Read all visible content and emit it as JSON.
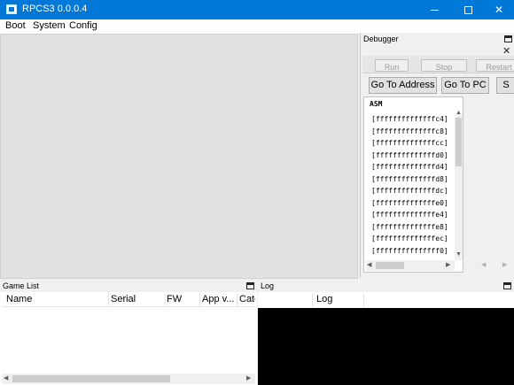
{
  "window": {
    "title": "RPCS3 0.0.0.4"
  },
  "menubar": {
    "items": [
      "Boot",
      "System",
      "Config"
    ]
  },
  "debugger": {
    "title": "Debugger",
    "close_glyph": "✕",
    "toolbar": [
      "Run",
      "Stop",
      "Restart"
    ],
    "buttons": {
      "go_to_address": "Go To Address",
      "go_to_pc": "Go To PC",
      "third": "S"
    },
    "asm_header": "ASM",
    "asm_rows": [
      "[ffffffffffffffc4]",
      "[ffffffffffffffc8]",
      "[ffffffffffffffcc]",
      "[ffffffffffffffd0]",
      "[ffffffffffffffd4]",
      "[ffffffffffffffd8]",
      "[ffffffffffffffdc]",
      "[ffffffffffffffe0]",
      "[ffffffffffffffe4]",
      "[ffffffffffffffe8]",
      "[ffffffffffffffec]",
      "[fffffffffffffff0]"
    ]
  },
  "gamelist": {
    "title": "Game List",
    "columns": [
      "Name",
      "Serial",
      "FW",
      "App v...",
      "Cate"
    ]
  },
  "log": {
    "title": "Log",
    "columns": [
      "",
      "Log"
    ]
  },
  "icons": {
    "app": "rpcs3-icon",
    "minimize": "minimize-icon",
    "maximize": "maximize-icon",
    "close": "close-icon",
    "float": "float-icon"
  },
  "colors": {
    "titlebar": "#0078d7",
    "log_background": "#000000"
  }
}
